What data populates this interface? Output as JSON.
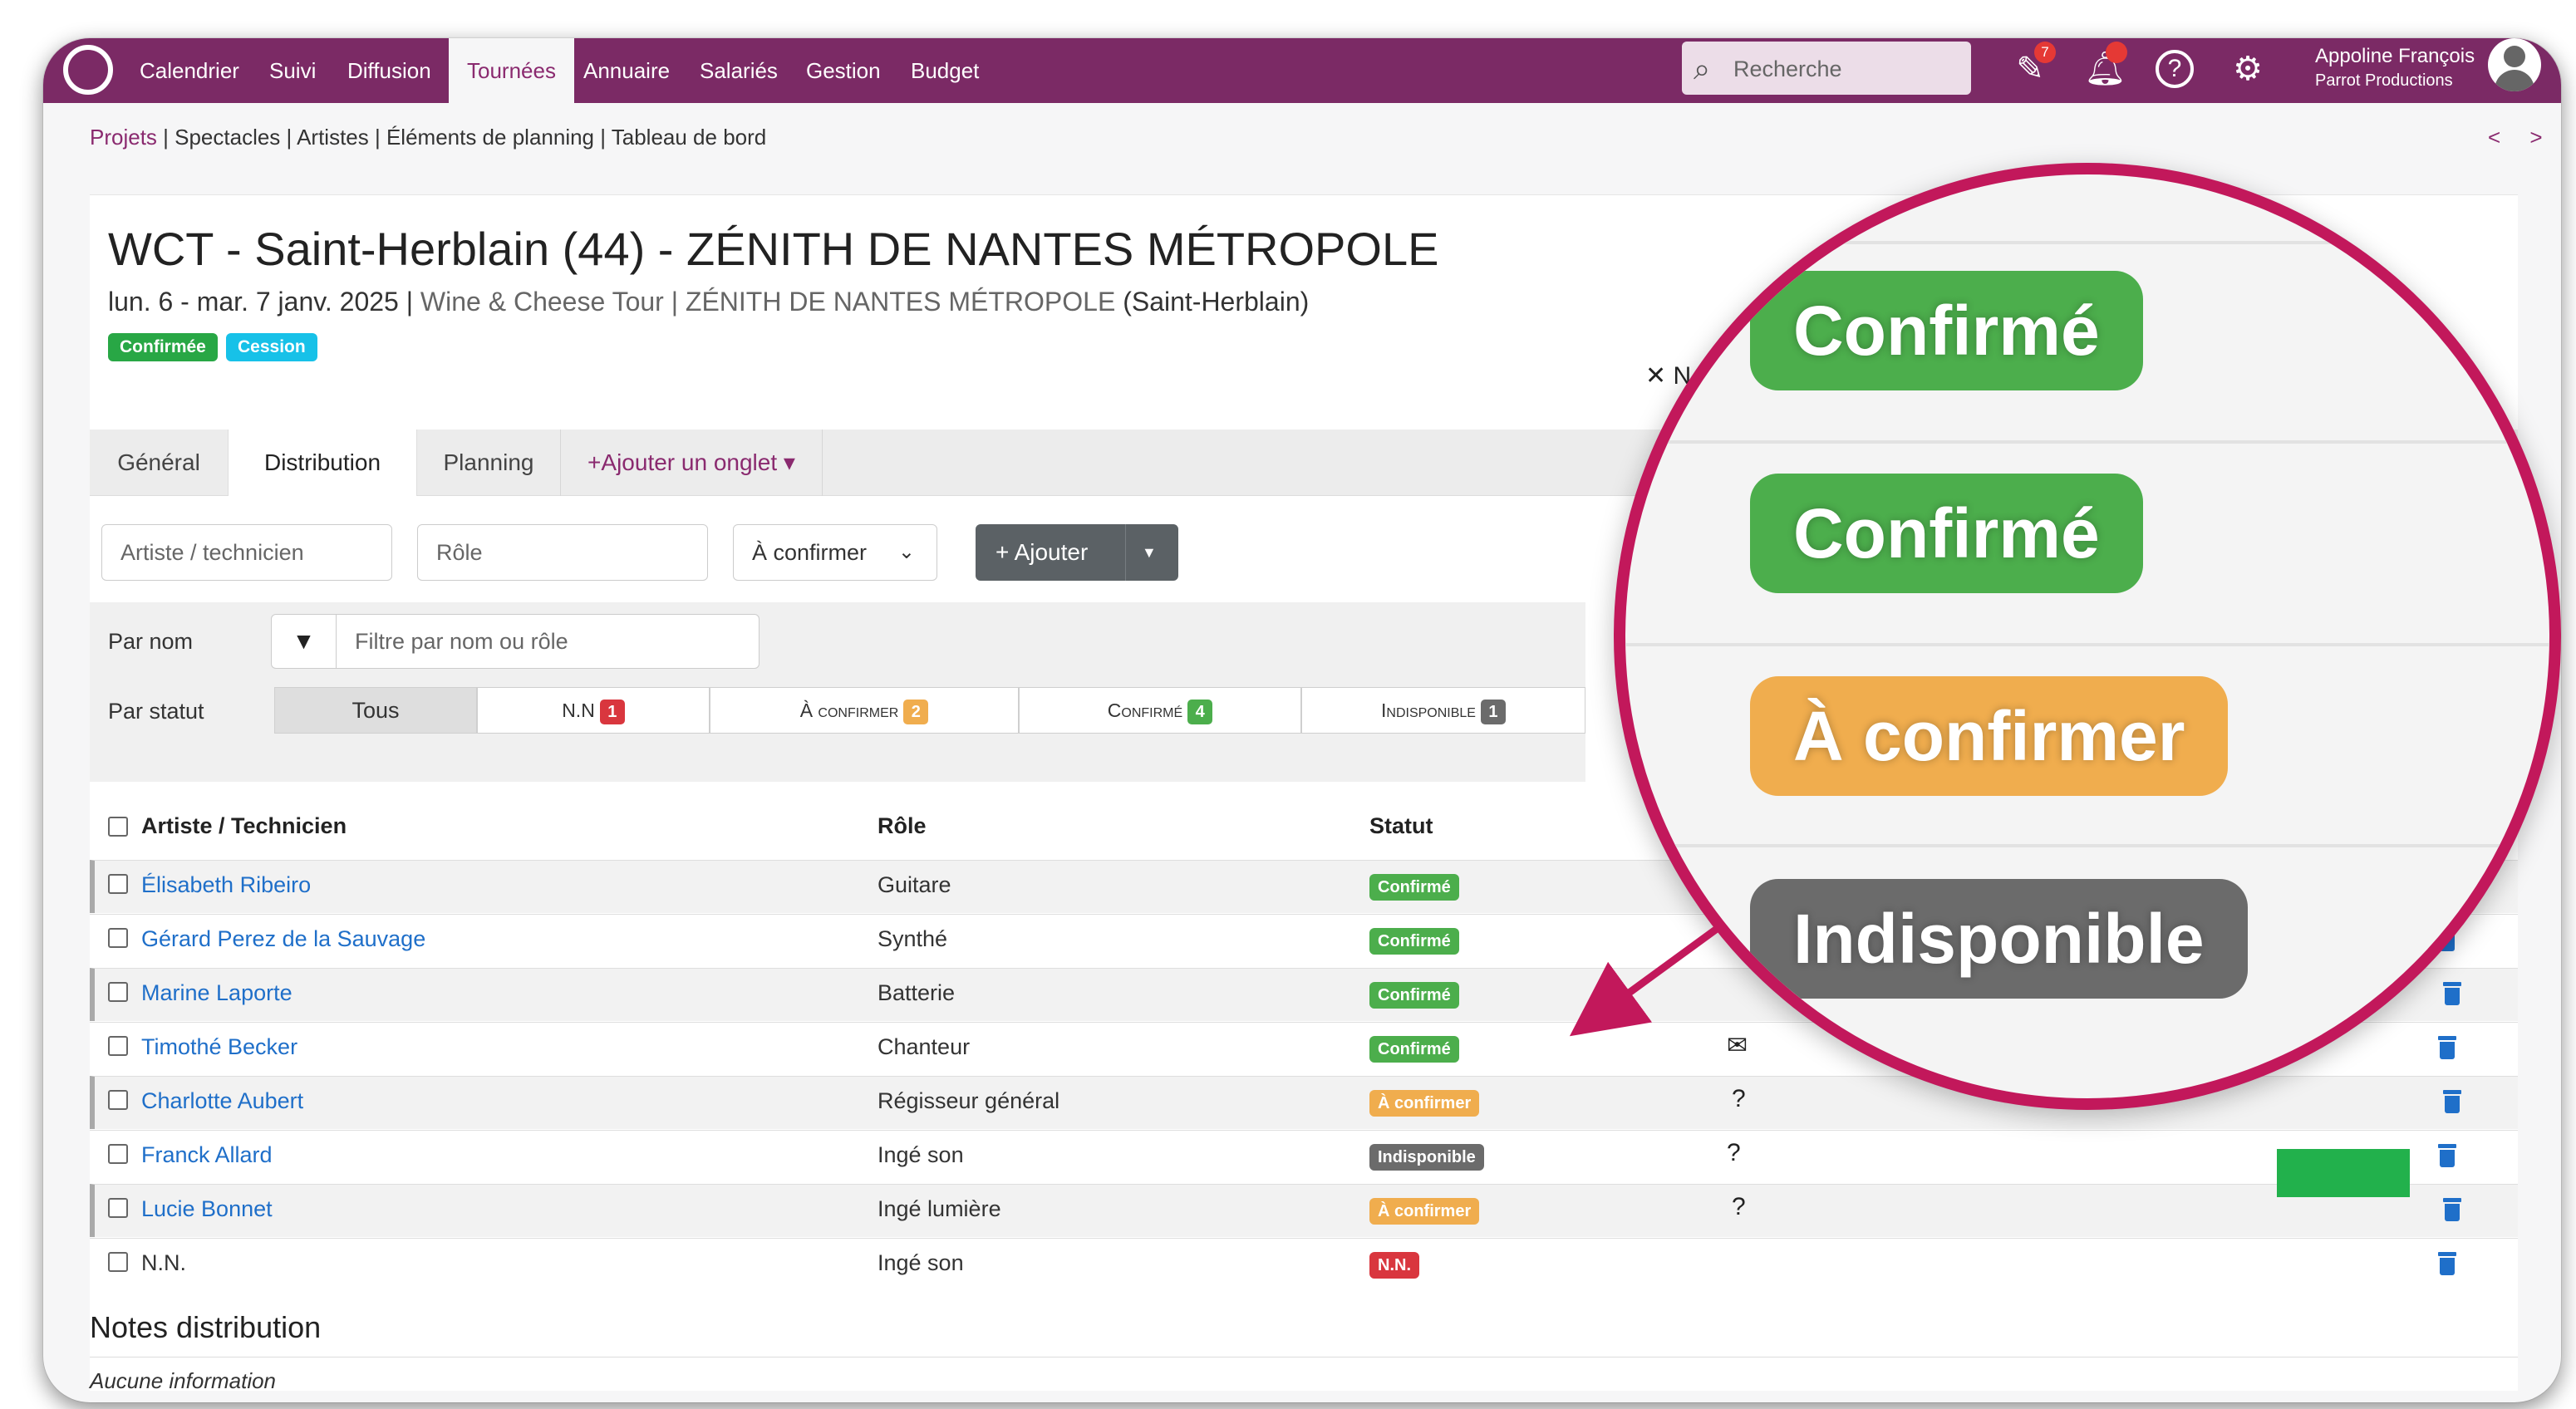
{
  "nav": {
    "items": [
      "Calendrier",
      "Suivi",
      "Diffusion",
      "Tournées",
      "Annuaire",
      "Salariés",
      "Gestion",
      "Budget"
    ],
    "active": "Tournées",
    "search_placeholder": "Recherche",
    "notif_count": "7",
    "user_name": "Appoline François",
    "user_company": "Parrot Productions"
  },
  "breadcrumb": {
    "first": "Projets",
    "rest": " | Spectacles | Artistes | Éléments de planning | Tableau de bord",
    "pager": "< >"
  },
  "event": {
    "title": "WCT - Saint-Herblain (44) - ZÉNITH DE NANTES MÉTROPOLE",
    "dates": "lun. 6 - mar. 7 janv. 2025 | ",
    "tour_venue": "Wine & Cheese Tour | ZÉNITH DE NANTES MÉTROPOLE ",
    "city": "(Saint-Herblain)",
    "tags": [
      {
        "label": "Confirmée",
        "color": "#28a745"
      },
      {
        "label": "Cession",
        "color": "#17c1e8"
      }
    ],
    "close_hint": "✕ N"
  },
  "tabs": {
    "general": "Général",
    "distribution": "Distribution",
    "planning": "Planning",
    "add": "+Ajouter un onglet ▾"
  },
  "form": {
    "artist_placeholder": "Artiste / technicien",
    "role_placeholder": "Rôle",
    "status_value": "À confirmer",
    "add_label": "+ Ajouter"
  },
  "filters": {
    "by_name_label": "Par nom",
    "name_placeholder": "Filtre par nom ou rôle",
    "by_status_label": "Par statut",
    "segments": [
      {
        "label": "Tous",
        "count": ""
      },
      {
        "label": "N.N",
        "count": "1"
      },
      {
        "label": "À confirmer",
        "count": "2"
      },
      {
        "label": "Confirmé",
        "count": "4"
      },
      {
        "label": "Indisponible",
        "count": "1"
      }
    ]
  },
  "table": {
    "headers": {
      "artist": "Artiste / Technicien",
      "role": "Rôle",
      "status": "Statut"
    },
    "rows": [
      {
        "name": "Élisabeth Ribeiro",
        "role": "Guitare",
        "status": "Confirmé",
        "extra": ""
      },
      {
        "name": "Gérard Perez de la Sauvage",
        "role": "Synthé",
        "status": "Confirmé",
        "extra": ""
      },
      {
        "name": "Marine Laporte",
        "role": "Batterie",
        "status": "Confirmé",
        "extra": ""
      },
      {
        "name": "Timothé Becker",
        "role": "Chanteur",
        "status": "Confirmé",
        "extra": "✉"
      },
      {
        "name": "Charlotte Aubert",
        "role": "Régisseur général",
        "status": "À confirmer",
        "extra": "?"
      },
      {
        "name": "Franck Allard",
        "role": "Ingé son",
        "status": "Indisponible",
        "extra": "?"
      },
      {
        "name": "Lucie Bonnet",
        "role": "Ingé lumière",
        "status": "À confirmer",
        "extra": "?"
      },
      {
        "name": "N.N.",
        "role": "Ingé son",
        "status": "N.N.",
        "extra": ""
      }
    ]
  },
  "notes": {
    "title": "Notes distribution",
    "empty": "Aucune information"
  },
  "zoom": {
    "badges": [
      "Confirmé",
      "Confirmé",
      "À confirmer",
      "Indisponible"
    ]
  },
  "colors": {
    "brand": "#7b2a65",
    "accent": "#8a2a6f",
    "confirmed": "#4cae4c",
    "to_confirm": "#f0ad4e",
    "unavailable": "#6b6b6b",
    "nn": "#d9363e",
    "zoom_ring": "#c2185b",
    "link": "#1f6fc9"
  }
}
